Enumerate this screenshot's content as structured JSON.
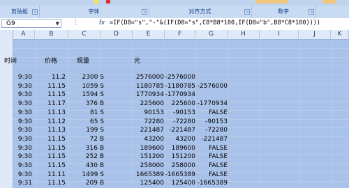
{
  "ribbon": {
    "groups": [
      {
        "label": "剪贴板"
      },
      {
        "label": "字体"
      },
      {
        "label": "对齐方式"
      },
      {
        "label": "数字"
      }
    ]
  },
  "formula_bar": {
    "name_box": "G9",
    "formula": "=IF(D8=\"s\",\"-\"&(IF(D8=\"s\",C8*B8*100,IF(D8=\"b\",B8*C8*100))))"
  },
  "columns": [
    "A",
    "B",
    "C",
    "D",
    "E",
    "F",
    "G",
    "H",
    "I",
    "J",
    "K"
  ],
  "headers": {
    "time": "时间",
    "price": "价格",
    "qty": "现量",
    "yuan": "元"
  },
  "rows": [
    {
      "a": "9:30",
      "b": "11.2",
      "c": "2300 S",
      "e": "2576000",
      "f": "-2576000",
      "g": ""
    },
    {
      "a": "9:30",
      "b": "11.15",
      "c": "1059 S",
      "e": "1180785",
      "f": "-1180785",
      "g": "-2576000"
    },
    {
      "a": "9:30",
      "b": "11.15",
      "c": "1594 S",
      "e": "1770934",
      "f": "-1770934",
      "g": ""
    },
    {
      "a": "9:30",
      "b": "11.17",
      "c": "376 B",
      "e": "225600",
      "f": "225600",
      "g": "-1770934"
    },
    {
      "a": "9:30",
      "b": "11.13",
      "c": "81 S",
      "e": "90153",
      "f": "-90153",
      "g": "FALSE"
    },
    {
      "a": "9:30",
      "b": "11.12",
      "c": "65 S",
      "e": "72280",
      "f": "-72280",
      "g": "-90153"
    },
    {
      "a": "9:30",
      "b": "11.13",
      "c": "199 S",
      "e": "221487",
      "f": "-221487",
      "g": "-72280"
    },
    {
      "a": "9:30",
      "b": "11.15",
      "c": "72 B",
      "e": "43200",
      "f": "43200",
      "g": "-221487"
    },
    {
      "a": "9:30",
      "b": "11.15",
      "c": "316 B",
      "e": "189600",
      "f": "189600",
      "g": "FALSE"
    },
    {
      "a": "9:30",
      "b": "11.15",
      "c": "252 B",
      "e": "151200",
      "f": "151200",
      "g": "FALSE"
    },
    {
      "a": "9:30",
      "b": "11.15",
      "c": "430 B",
      "e": "258000",
      "f": "258000",
      "g": "FALSE"
    },
    {
      "a": "9:30",
      "b": "11.11",
      "c": "1499 S",
      "e": "1665389",
      "f": "-1665389",
      "g": "FALSE"
    },
    {
      "a": "9:31",
      "b": "11.15",
      "c": "209 B",
      "e": "125400",
      "f": "125400",
      "g": "-1665389"
    }
  ]
}
